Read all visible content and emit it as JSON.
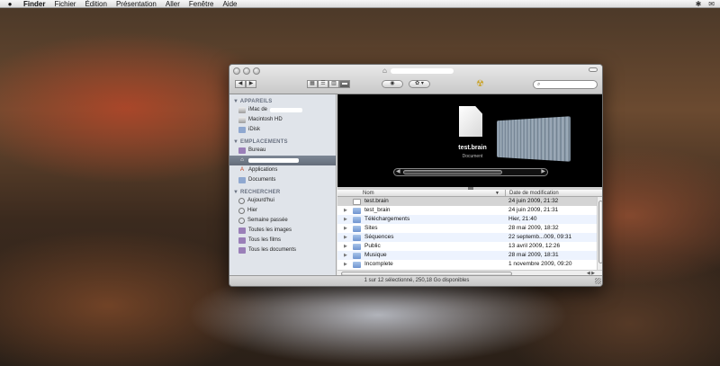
{
  "menubar": {
    "apple": "",
    "items": [
      "Finder",
      "Fichier",
      "Édition",
      "Présentation",
      "Aller",
      "Fenêtre",
      "Aide"
    ],
    "right_icons": [
      "bluetooth-icon",
      "mail-icon"
    ]
  },
  "window": {
    "title": "",
    "toolbar": {
      "back": "◀",
      "forward": "▶",
      "views": [
        "▦",
        "☰",
        "▥",
        "▬"
      ],
      "eye": "◉",
      "action": "✿ ▾",
      "burn": "☢",
      "search_placeholder": ""
    },
    "sidebar": {
      "sections": [
        {
          "title": "APPAREILS",
          "items": [
            {
              "label": "iMac de",
              "icon": "imac-icon"
            },
            {
              "label": "Macintosh HD",
              "icon": "hard-drive-icon"
            },
            {
              "label": "iDisk",
              "icon": "idisk-icon"
            }
          ]
        },
        {
          "title": "EMPLACEMENTS",
          "items": [
            {
              "label": "Bureau",
              "icon": "desktop-icon"
            },
            {
              "label": "",
              "icon": "home-icon"
            },
            {
              "label": "Applications",
              "icon": "applications-icon"
            },
            {
              "label": "Documents",
              "icon": "documents-folder-icon"
            }
          ]
        },
        {
          "title": "RECHERCHER",
          "items": [
            {
              "label": "Aujourd'hui",
              "icon": "clock-icon"
            },
            {
              "label": "Hier",
              "icon": "clock-icon"
            },
            {
              "label": "Semaine passée",
              "icon": "clock-icon"
            },
            {
              "label": "Toutes les images",
              "icon": "smart-folder-icon"
            },
            {
              "label": "Tous les films",
              "icon": "smart-folder-icon"
            },
            {
              "label": "Tous les documents",
              "icon": "smart-folder-icon"
            }
          ]
        }
      ]
    },
    "coverflow": {
      "name": "test.brain",
      "kind": "Document"
    },
    "list": {
      "col_name": "Nom",
      "col_date": "Date de modification",
      "rows": [
        {
          "name": "test.brain",
          "date": "24 juin 2009, 21:32",
          "type": "document"
        },
        {
          "name": "test_brain",
          "date": "24 juin 2009, 21:31",
          "type": "folder"
        },
        {
          "name": "Téléchargements",
          "date": "Hier, 21:40",
          "type": "folder"
        },
        {
          "name": "Sites",
          "date": "28 mai 2009, 18:32",
          "type": "folder"
        },
        {
          "name": "Séquences",
          "date": "22 septemb...009, 09:31",
          "type": "folder"
        },
        {
          "name": "Public",
          "date": "13 avril 2009, 12:26",
          "type": "folder"
        },
        {
          "name": "Musique",
          "date": "28 mai 2009, 18:31",
          "type": "folder"
        },
        {
          "name": "Incomplete",
          "date": "1 novembre 2009, 09:20",
          "type": "folder"
        }
      ]
    },
    "status": "1 sur 12 sélectionné, 250,18 Go disponibles"
  }
}
